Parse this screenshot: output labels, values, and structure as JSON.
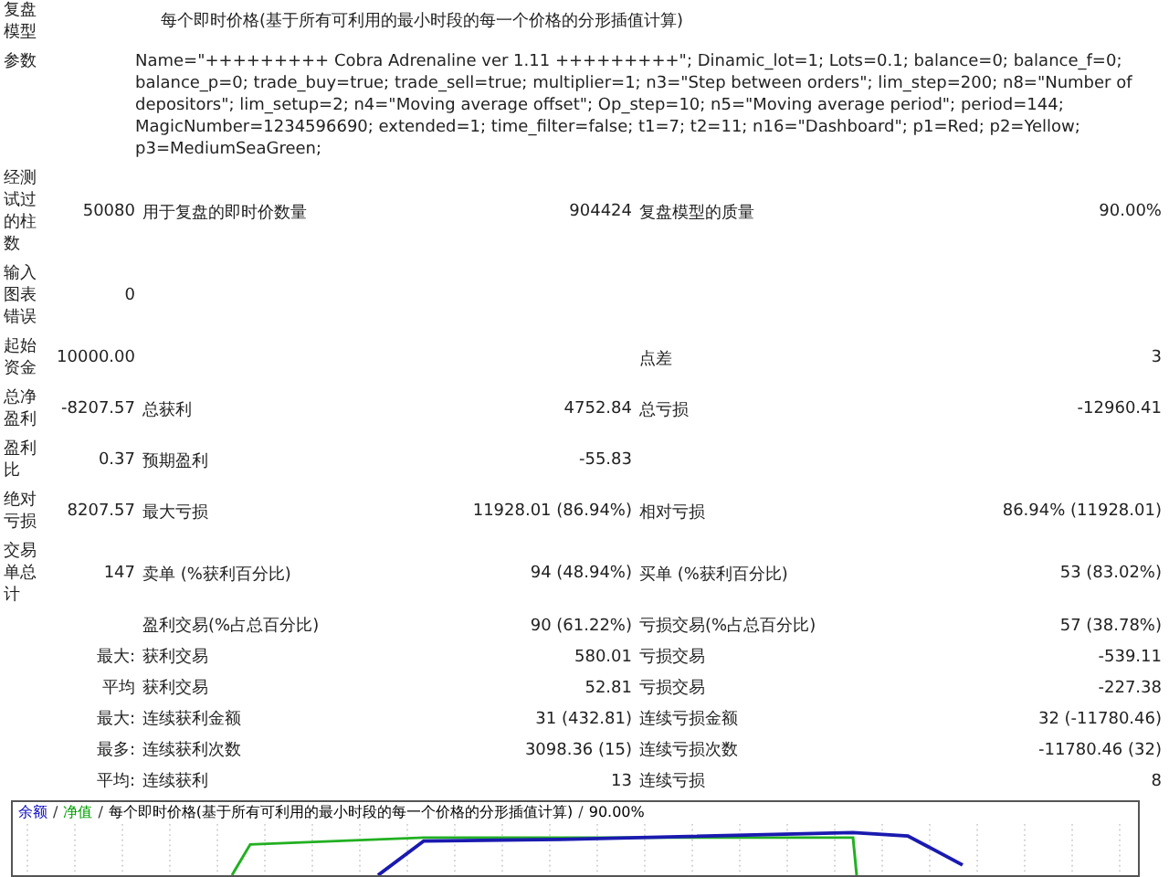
{
  "rows": [
    {
      "kind": "text",
      "label": "复盘模型",
      "text": "每个即时价格(基于所有可利用的最小时段的每一个价格的分形插值计算)"
    },
    {
      "kind": "text",
      "label": "参数",
      "text": "Name=\"+++++++++ Cobra Adrenaline ver 1.11 +++++++++\"; Dinamic_lot=1; Lots=0.1; balance=0; balance_f=0; balance_p=0; trade_buy=true; trade_sell=true; multiplier=1; n3=\"Step between orders\"; lim_step=200; n8=\"Number of depositors\"; lim_setup=2; n4=\"Moving average offset\"; Op_step=10; n5=\"Moving average period\"; period=144; MagicNumber=1234596690; extended=1; time_filter=false; t1=7; t2=11; n16=\"Dashboard\"; p1=Red; p2=Yellow; p3=MediumSeaGreen;"
    },
    {
      "kind": "main",
      "label": "经测试过的柱数",
      "value": "50080",
      "left": {
        "label": "用于复盘的即时价数量",
        "value": "904424"
      },
      "right": {
        "label": "复盘模型的质量",
        "value": "90.00%"
      }
    },
    {
      "kind": "main",
      "label": "输入图表错误",
      "value": "0"
    },
    {
      "kind": "main",
      "label": "起始资金",
      "value": "10000.00",
      "right": {
        "label": "点差",
        "value": "3"
      }
    },
    {
      "kind": "main",
      "label": "总净盈利",
      "value": "-8207.57",
      "left": {
        "label": "总获利",
        "value": "4752.84"
      },
      "right": {
        "label": "总亏损",
        "value": "-12960.41"
      }
    },
    {
      "kind": "main",
      "label": "盈利比",
      "value": "0.37",
      "left": {
        "label": "预期盈利",
        "value": "-55.83"
      }
    },
    {
      "kind": "main",
      "label": "绝对亏损",
      "value": "8207.57",
      "left": {
        "label": "最大亏损",
        "value": "11928.01 (86.94%)"
      },
      "right": {
        "label": "相对亏损",
        "value": "86.94% (11928.01)"
      }
    },
    {
      "kind": "main",
      "label": "交易单总计",
      "value": "147",
      "left": {
        "label": "卖单 (%获利百分比)",
        "value": "94 (48.94%)"
      },
      "right": {
        "label": "买单 (%获利百分比)",
        "value": "53 (83.02%)"
      }
    },
    {
      "kind": "sub",
      "left": {
        "label": "盈利交易(%占总百分比)",
        "value": "90 (61.22%)"
      },
      "right": {
        "label": "亏损交易(%占总百分比)",
        "value": "57 (38.78%)"
      }
    },
    {
      "kind": "sub",
      "label": "最大:",
      "left": {
        "label": "获利交易",
        "value": "580.01"
      },
      "right": {
        "label": "亏损交易",
        "value": "-539.11"
      }
    },
    {
      "kind": "sub",
      "label": "平均",
      "left": {
        "label": "获利交易",
        "value": "52.81"
      },
      "right": {
        "label": "亏损交易",
        "value": "-227.38"
      }
    },
    {
      "kind": "sub",
      "label": "最大:",
      "left": {
        "label": "连续获利金额",
        "value": "31 (432.81)"
      },
      "right": {
        "label": "连续亏损金额",
        "value": "32 (-11780.46)"
      }
    },
    {
      "kind": "sub",
      "label": "最多:",
      "left": {
        "label": "连续获利次数",
        "value": "3098.36 (15)"
      },
      "right": {
        "label": "连续亏损次数",
        "value": "-11780.46 (32)"
      }
    },
    {
      "kind": "sub",
      "label": "平均:",
      "left": {
        "label": "连续获利",
        "value": "13"
      },
      "right": {
        "label": "连续亏损",
        "value": "8"
      }
    }
  ],
  "chart": {
    "separator": "/",
    "legend": [
      {
        "text": "余额",
        "color": "#0000c0"
      },
      {
        "text": "净值",
        "color": "#00a000"
      },
      {
        "text": "每个即时价格(基于所有可利用的最小时段的每一个价格的分形插值计算)",
        "color": "#000000"
      },
      {
        "text": "90.00%",
        "color": "#000000"
      }
    ]
  }
}
